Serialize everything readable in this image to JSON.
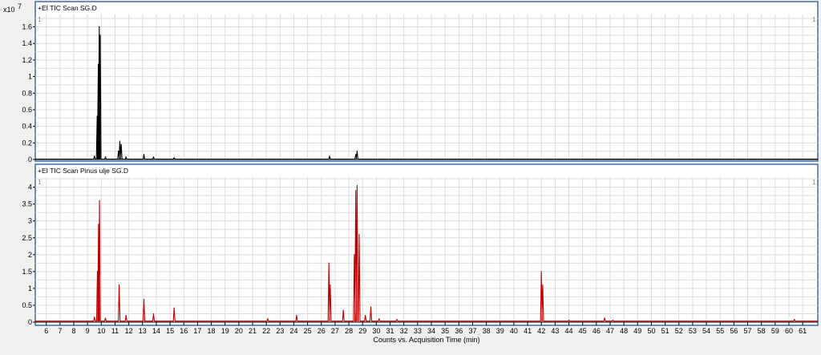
{
  "chart_data": [
    {
      "type": "line",
      "title": "+EI TIC Scan SG.D",
      "y_multiplier": "x10",
      "y_exponent": "7",
      "corner_left": "1",
      "corner_right": "1",
      "color": "#000000",
      "xlim": [
        5.2,
        62.1
      ],
      "ylim": [
        0,
        1.75
      ],
      "yticks": [
        "0",
        "0.2",
        "0.4",
        "0.6",
        "0.8",
        "1",
        "1.2",
        "1.4",
        "1.6"
      ],
      "grid": true,
      "series": [
        {
          "baseline": 0.005,
          "peaks": [
            {
              "x": 9.5,
              "y": 0.04
            },
            {
              "x": 9.7,
              "y": 0.52
            },
            {
              "x": 9.78,
              "y": 1.15
            },
            {
              "x": 9.85,
              "y": 1.6
            },
            {
              "x": 9.92,
              "y": 1.5
            },
            {
              "x": 10.3,
              "y": 0.03
            },
            {
              "x": 11.25,
              "y": 0.1
            },
            {
              "x": 11.35,
              "y": 0.22
            },
            {
              "x": 11.45,
              "y": 0.18
            },
            {
              "x": 11.8,
              "y": 0.03
            },
            {
              "x": 13.1,
              "y": 0.06
            },
            {
              "x": 13.8,
              "y": 0.03
            },
            {
              "x": 15.3,
              "y": 0.02
            },
            {
              "x": 26.6,
              "y": 0.04
            },
            {
              "x": 28.5,
              "y": 0.06
            },
            {
              "x": 28.6,
              "y": 0.1
            }
          ]
        }
      ]
    },
    {
      "type": "line",
      "title": "+EI TIC Scan Pinus ulje SG.D",
      "corner_left": "1",
      "corner_right": "1",
      "color": "#c00000",
      "xlim": [
        5.2,
        62.1
      ],
      "ylim": [
        0,
        4.3
      ],
      "yticks": [
        "0",
        "0.5",
        "1",
        "1.5",
        "2",
        "2.5",
        "3",
        "3.5",
        "4"
      ],
      "grid": true,
      "xlabel": "Counts vs. Acquisition Time (min)",
      "xticks": [
        "6",
        "7",
        "8",
        "9",
        "10",
        "11",
        "12",
        "13",
        "14",
        "15",
        "16",
        "17",
        "18",
        "19",
        "20",
        "21",
        "22",
        "23",
        "24",
        "25",
        "26",
        "27",
        "28",
        "29",
        "30",
        "31",
        "32",
        "33",
        "34",
        "35",
        "36",
        "37",
        "38",
        "39",
        "40",
        "41",
        "42",
        "43",
        "44",
        "45",
        "46",
        "47",
        "48",
        "49",
        "50",
        "51",
        "52",
        "53",
        "54",
        "55",
        "56",
        "57",
        "58",
        "59",
        "60",
        "61"
      ],
      "series": [
        {
          "baseline": 0.03,
          "peaks": [
            {
              "x": 9.5,
              "y": 0.15
            },
            {
              "x": 9.72,
              "y": 1.5
            },
            {
              "x": 9.8,
              "y": 2.9
            },
            {
              "x": 9.87,
              "y": 3.6
            },
            {
              "x": 10.3,
              "y": 0.12
            },
            {
              "x": 11.3,
              "y": 1.1
            },
            {
              "x": 11.8,
              "y": 0.2
            },
            {
              "x": 13.1,
              "y": 0.68
            },
            {
              "x": 13.8,
              "y": 0.25
            },
            {
              "x": 15.3,
              "y": 0.42
            },
            {
              "x": 22.1,
              "y": 0.1
            },
            {
              "x": 24.2,
              "y": 0.2
            },
            {
              "x": 26.55,
              "y": 1.75
            },
            {
              "x": 26.65,
              "y": 1.1
            },
            {
              "x": 27.6,
              "y": 0.35
            },
            {
              "x": 28.4,
              "y": 2.0
            },
            {
              "x": 28.5,
              "y": 3.9
            },
            {
              "x": 28.6,
              "y": 4.05
            },
            {
              "x": 28.75,
              "y": 2.6
            },
            {
              "x": 29.2,
              "y": 0.2
            },
            {
              "x": 29.6,
              "y": 0.45
            },
            {
              "x": 30.2,
              "y": 0.1
            },
            {
              "x": 31.5,
              "y": 0.08
            },
            {
              "x": 42.0,
              "y": 1.5
            },
            {
              "x": 42.1,
              "y": 1.1
            },
            {
              "x": 44.0,
              "y": 0.06
            },
            {
              "x": 46.6,
              "y": 0.12
            },
            {
              "x": 47.2,
              "y": 0.06
            },
            {
              "x": 60.4,
              "y": 0.08
            }
          ]
        }
      ]
    }
  ]
}
